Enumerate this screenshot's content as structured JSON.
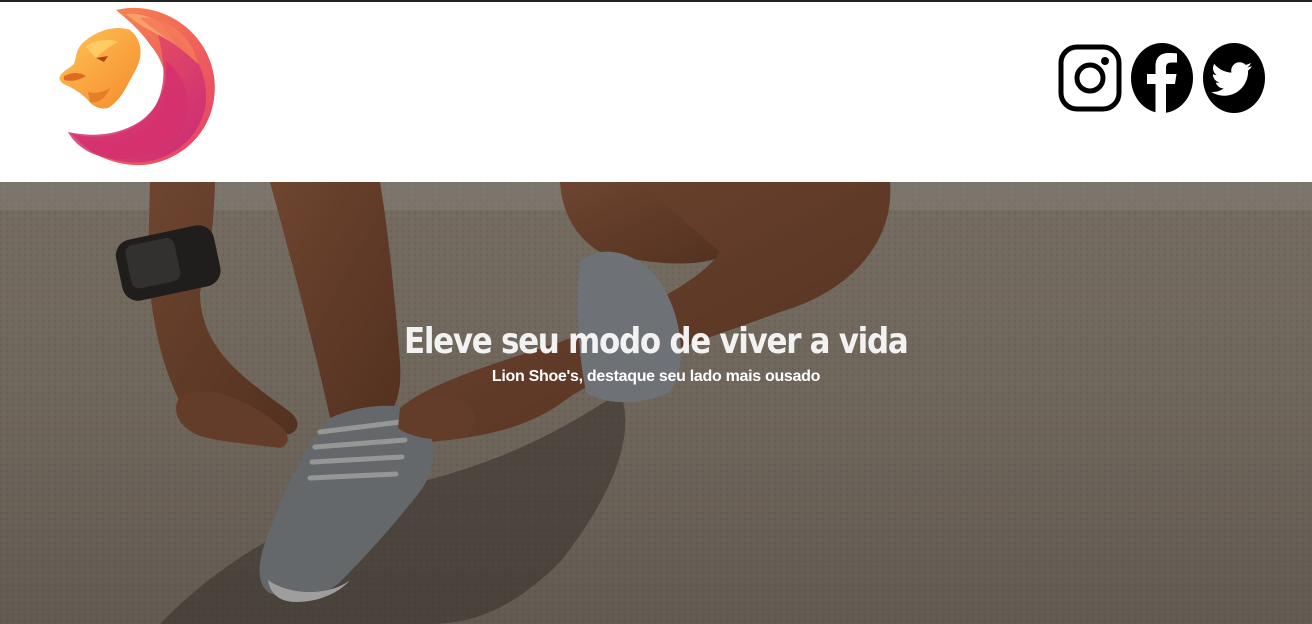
{
  "header": {
    "logo_icon": "lion-head-logo-icon",
    "brand_colors": [
      "#f8a54a",
      "#f4723c",
      "#e8415f",
      "#c8267a"
    ],
    "social": [
      {
        "name": "instagram",
        "icon": "instagram-icon"
      },
      {
        "name": "facebook",
        "icon": "facebook-icon"
      },
      {
        "name": "twitter",
        "icon": "twitter-icon"
      }
    ]
  },
  "hero": {
    "background": "runner tying shoelace photo",
    "title": "Eleve seu modo de viver a vida",
    "subtitle": "Lion Shoe's, destaque seu lado mais ousado"
  }
}
